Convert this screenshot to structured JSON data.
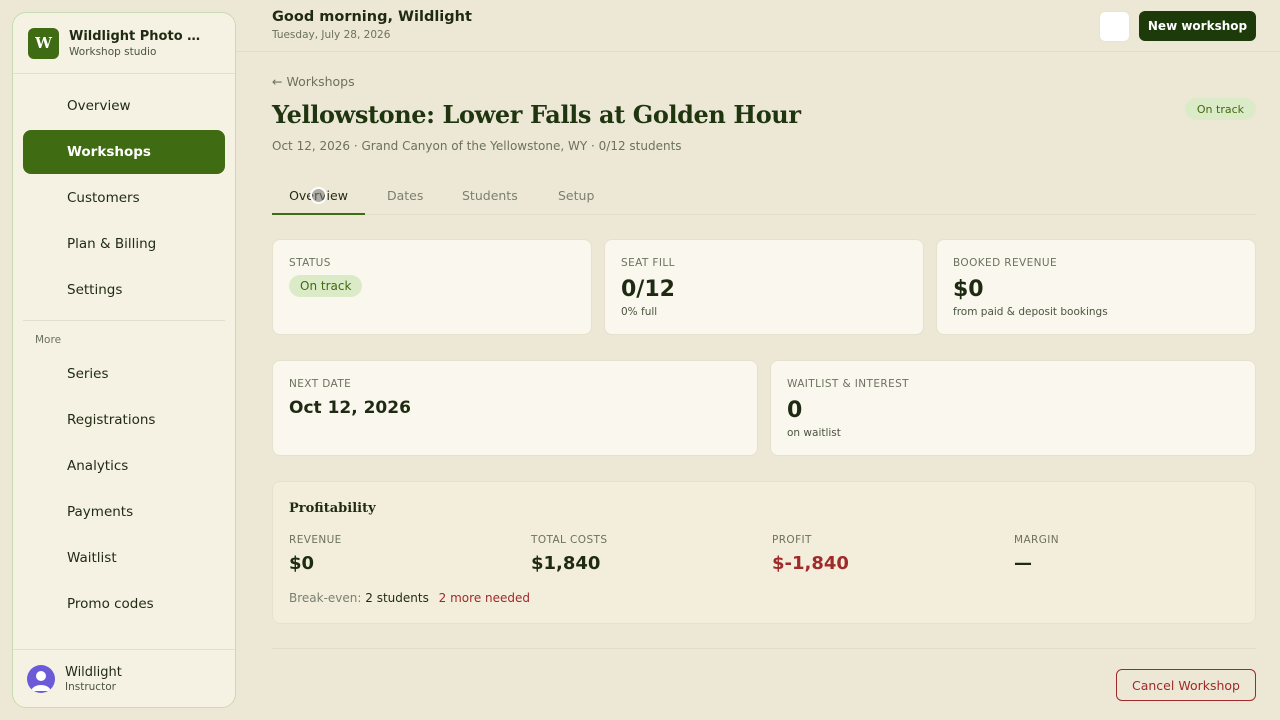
{
  "brand": {
    "logo_letter": "W",
    "name": "Wildlight Photo Workshops",
    "subtitle": "Workshop studio"
  },
  "sidebar": {
    "items": [
      {
        "label": "Overview"
      },
      {
        "label": "Workshops",
        "active": true
      },
      {
        "label": "Customers"
      },
      {
        "label": "Plan & Billing"
      },
      {
        "label": "Settings"
      }
    ],
    "more_label": "More",
    "more_items": [
      {
        "label": "Series"
      },
      {
        "label": "Registrations"
      },
      {
        "label": "Analytics"
      },
      {
        "label": "Payments"
      },
      {
        "label": "Waitlist"
      },
      {
        "label": "Promo codes"
      }
    ]
  },
  "user": {
    "name": "Wildlight",
    "role": "Instructor"
  },
  "header": {
    "greeting": "Good morning, Wildlight",
    "date": "Tuesday, July 28, 2026",
    "new_button": "New workshop"
  },
  "page": {
    "breadcrumb": "← Workshops",
    "title": "Yellowstone: Lower Falls at Golden Hour",
    "status_badge": "On track",
    "subtitle": "Oct 12, 2026 · Grand Canyon of the Yellowstone, WY · 0/12 students"
  },
  "tabs": [
    {
      "label": "Overview",
      "active": true
    },
    {
      "label": "Dates"
    },
    {
      "label": "Students"
    },
    {
      "label": "Setup"
    }
  ],
  "cards": {
    "status": {
      "label": "STATUS",
      "value": "On track"
    },
    "seat_fill": {
      "label": "SEAT FILL",
      "value": "0/12",
      "note": "0% full"
    },
    "booked_revenue": {
      "label": "BOOKED REVENUE",
      "value": "$0",
      "note": "from paid & deposit bookings"
    },
    "next_date": {
      "label": "NEXT DATE",
      "value": "Oct 12, 2026"
    },
    "waitlist": {
      "label": "WAITLIST & INTEREST",
      "value": "0",
      "note": "on waitlist"
    }
  },
  "profitability": {
    "title": "Profitability",
    "revenue": {
      "label": "REVENUE",
      "value": "$0"
    },
    "total_costs": {
      "label": "TOTAL COSTS",
      "value": "$1,840"
    },
    "profit": {
      "label": "PROFIT",
      "value": "$-1,840"
    },
    "margin": {
      "label": "MARGIN",
      "value": "—"
    },
    "breakeven_label": "Break-even:",
    "breakeven_count": "2 students",
    "breakeven_more": "2 more needed"
  },
  "actions": {
    "cancel": "Cancel Workshop"
  },
  "colors": {
    "accent": "#3f6b12",
    "primary_dark": "#1c3a0a",
    "danger": "#a02a2a",
    "background": "#ede8d6"
  }
}
